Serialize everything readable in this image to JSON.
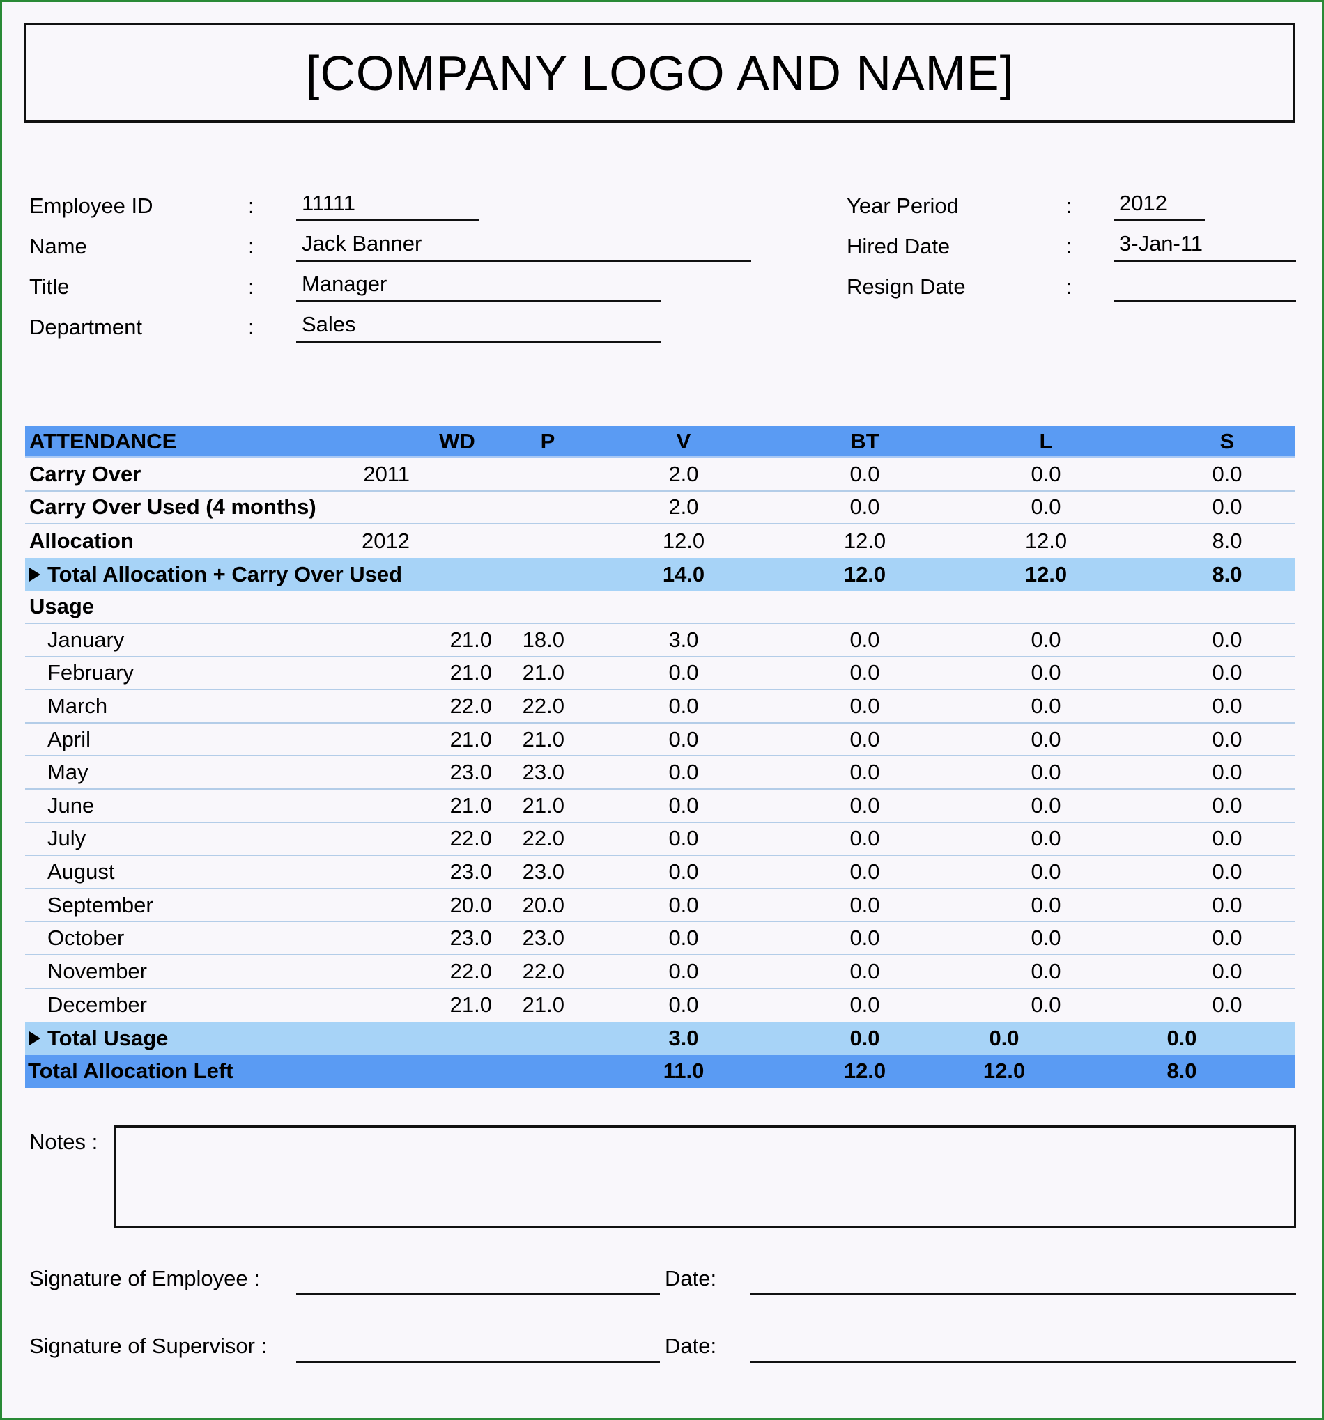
{
  "header": {
    "title": "[COMPANY LOGO AND NAME]"
  },
  "employee_info": {
    "left": [
      {
        "label": "Employee ID",
        "colon": ":",
        "value": "11111"
      },
      {
        "label": "Name",
        "colon": ":",
        "value": "Jack Banner"
      },
      {
        "label": "Title",
        "colon": ":",
        "value": "Manager"
      },
      {
        "label": "Department",
        "colon": ":",
        "value": "Sales"
      }
    ],
    "right": [
      {
        "label": "Year Period",
        "colon": ":",
        "value": "2012"
      },
      {
        "label": "Hired Date",
        "colon": ":",
        "value": "3-Jan-11"
      },
      {
        "label": "Resign Date",
        "colon": ":",
        "value": ""
      }
    ]
  },
  "attendance": {
    "headers": {
      "title": "ATTENDANCE",
      "wd": "WD",
      "p": "P",
      "v": "V",
      "bt": "BT",
      "l": "L",
      "s": "S"
    },
    "carry_over": {
      "label": "Carry Over",
      "year": "2011",
      "v": "2.0",
      "bt": "0.0",
      "l": "0.0",
      "s": "0.0"
    },
    "carry_over_used": {
      "label": "Carry Over Used (4 months)",
      "v": "2.0",
      "bt": "0.0",
      "l": "0.0",
      "s": "0.0"
    },
    "allocation": {
      "label": "Allocation",
      "year": "2012",
      "v": "12.0",
      "bt": "12.0",
      "l": "12.0",
      "s": "8.0"
    },
    "total_allocation": {
      "label": "Total Allocation + Carry Over Used",
      "v": "14.0",
      "bt": "12.0",
      "l": "12.0",
      "s": "8.0"
    },
    "usage_label": "Usage",
    "months": [
      {
        "month": "January",
        "wd": "21.0",
        "p": "18.0",
        "v": "3.0",
        "bt": "0.0",
        "l": "0.0",
        "s": "0.0"
      },
      {
        "month": "February",
        "wd": "21.0",
        "p": "21.0",
        "v": "0.0",
        "bt": "0.0",
        "l": "0.0",
        "s": "0.0"
      },
      {
        "month": "March",
        "wd": "22.0",
        "p": "22.0",
        "v": "0.0",
        "bt": "0.0",
        "l": "0.0",
        "s": "0.0"
      },
      {
        "month": "April",
        "wd": "21.0",
        "p": "21.0",
        "v": "0.0",
        "bt": "0.0",
        "l": "0.0",
        "s": "0.0"
      },
      {
        "month": "May",
        "wd": "23.0",
        "p": "23.0",
        "v": "0.0",
        "bt": "0.0",
        "l": "0.0",
        "s": "0.0"
      },
      {
        "month": "June",
        "wd": "21.0",
        "p": "21.0",
        "v": "0.0",
        "bt": "0.0",
        "l": "0.0",
        "s": "0.0"
      },
      {
        "month": "July",
        "wd": "22.0",
        "p": "22.0",
        "v": "0.0",
        "bt": "0.0",
        "l": "0.0",
        "s": "0.0"
      },
      {
        "month": "August",
        "wd": "23.0",
        "p": "23.0",
        "v": "0.0",
        "bt": "0.0",
        "l": "0.0",
        "s": "0.0"
      },
      {
        "month": "September",
        "wd": "20.0",
        "p": "20.0",
        "v": "0.0",
        "bt": "0.0",
        "l": "0.0",
        "s": "0.0"
      },
      {
        "month": "October",
        "wd": "23.0",
        "p": "23.0",
        "v": "0.0",
        "bt": "0.0",
        "l": "0.0",
        "s": "0.0"
      },
      {
        "month": "November",
        "wd": "22.0",
        "p": "22.0",
        "v": "0.0",
        "bt": "0.0",
        "l": "0.0",
        "s": "0.0"
      },
      {
        "month": "December",
        "wd": "21.0",
        "p": "21.0",
        "v": "0.0",
        "bt": "0.0",
        "l": "0.0",
        "s": "0.0"
      }
    ],
    "total_usage": {
      "label": "Total Usage",
      "v": "3.0",
      "bt": "0.0",
      "l": "0.0",
      "s": "0.0"
    },
    "total_left": {
      "label": "Total Allocation Left",
      "v": "11.0",
      "bt": "12.0",
      "l": "12.0",
      "s": "8.0"
    }
  },
  "notes": {
    "label": "Notes :",
    "value": ""
  },
  "signatures": [
    {
      "label": "Signature of Employee :",
      "date_label": "Date:"
    },
    {
      "label": "Signature of Supervisor :",
      "date_label": "Date:"
    }
  ],
  "colors": {
    "header_blue": "#5a9bf3",
    "subtotal_blue": "#a7d3f7",
    "row_divider": "#b4cde8",
    "frame_green": "#2a8a36"
  }
}
